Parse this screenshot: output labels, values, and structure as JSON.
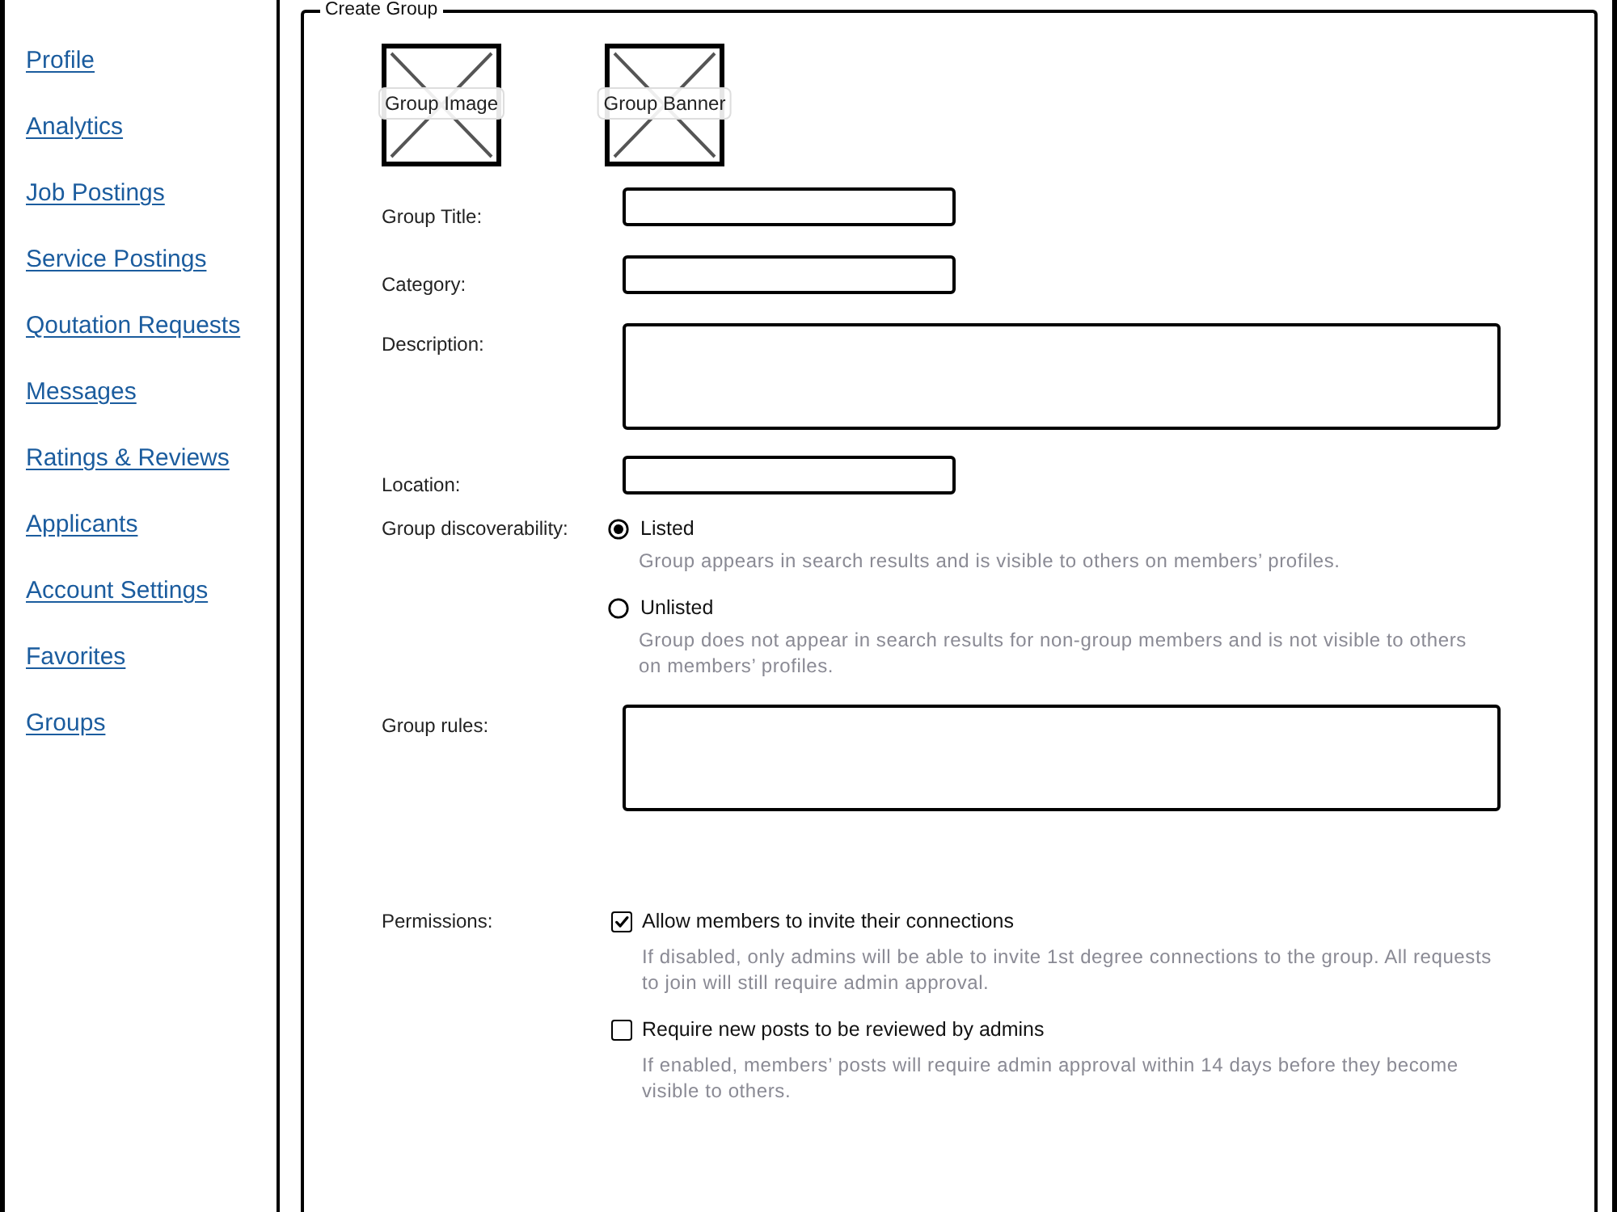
{
  "sidebar": {
    "items": [
      {
        "label": "Profile"
      },
      {
        "label": "Analytics"
      },
      {
        "label": "Job Postings"
      },
      {
        "label": "Service Postings"
      },
      {
        "label": "Qoutation Requests"
      },
      {
        "label": "Messages"
      },
      {
        "label": "Ratings & Reviews"
      },
      {
        "label": "Applicants"
      },
      {
        "label": "Account Settings"
      },
      {
        "label": "Favorites"
      },
      {
        "label": "Groups"
      }
    ]
  },
  "form": {
    "title": "Create Group",
    "images": [
      {
        "label": "Group Image"
      },
      {
        "label": "Group Banner"
      }
    ],
    "rows": [
      {
        "kind": "input",
        "label": "Group Title:"
      },
      {
        "kind": "input",
        "label": "Category:"
      },
      {
        "kind": "textarea",
        "label": "Description:"
      },
      {
        "kind": "input",
        "label": "Location:"
      },
      {
        "kind": "radio_group",
        "label": "Group discoverability:",
        "options": [
          {
            "label": "Listed",
            "description": "Group appears in search results and is visible to others on members’ profiles.",
            "selected": true
          },
          {
            "label": "Unlisted",
            "description": "Group does not appear in search results for non-group members and is not visible to others on members’ profiles.",
            "selected": false
          }
        ]
      },
      {
        "kind": "textarea",
        "label": "Group rules:"
      },
      {
        "kind": "checkbox_group",
        "label": "Permissions:",
        "options": [
          {
            "label": "Allow members to invite their connections",
            "description": "If disabled, only admins will be able to invite 1st degree connections to the group. All requests to join will still require admin approval.",
            "checked": true
          },
          {
            "label": "Require new posts to be reviewed by admins",
            "description": "If enabled, members’ posts will require admin approval within 14 days before they become visible to others.",
            "checked": false
          }
        ]
      }
    ]
  }
}
